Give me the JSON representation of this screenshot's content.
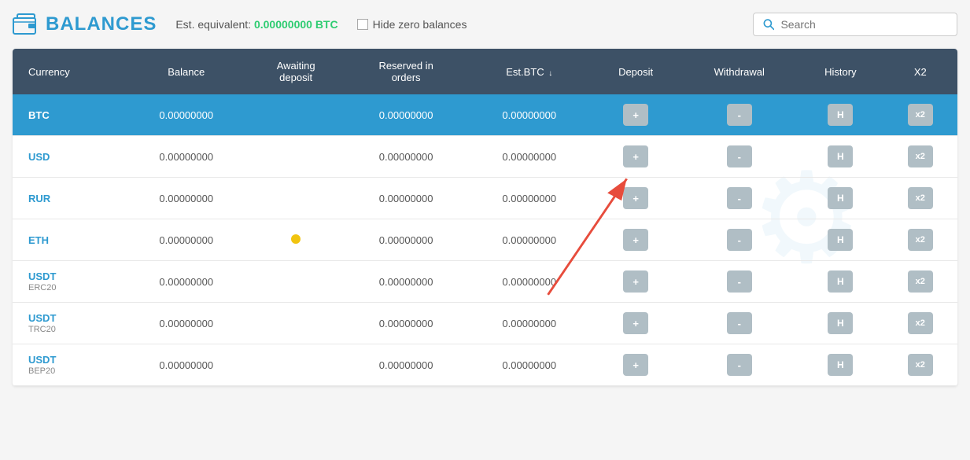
{
  "header": {
    "title": "BALANCES",
    "est_label": "Est. equivalent:",
    "est_value": "0.00000000 BTC",
    "hide_zero_label": "Hide zero balances",
    "search_placeholder": "Search"
  },
  "table": {
    "columns": [
      {
        "key": "currency",
        "label": "Currency"
      },
      {
        "key": "balance",
        "label": "Balance"
      },
      {
        "key": "awaiting",
        "label": "Awaiting deposit"
      },
      {
        "key": "reserved",
        "label": "Reserved in orders"
      },
      {
        "key": "estbtc",
        "label": "Est.BTC",
        "sort": true
      },
      {
        "key": "deposit",
        "label": "Deposit"
      },
      {
        "key": "withdrawal",
        "label": "Withdrawal"
      },
      {
        "key": "history",
        "label": "History"
      },
      {
        "key": "x2",
        "label": "X2"
      }
    ],
    "rows": [
      {
        "currency": "BTC",
        "currency_sub": "",
        "balance": "0.00000000",
        "awaiting": "",
        "reserved": "0.00000000",
        "estbtc": "0.00000000",
        "active": true
      },
      {
        "currency": "USD",
        "currency_sub": "",
        "balance": "0.00000000",
        "awaiting": "",
        "reserved": "0.00000000",
        "estbtc": "0.00000000",
        "active": false
      },
      {
        "currency": "RUR",
        "currency_sub": "",
        "balance": "0.00000000",
        "awaiting": "",
        "reserved": "0.00000000",
        "estbtc": "0.00000000",
        "active": false
      },
      {
        "currency": "ETH",
        "currency_sub": "",
        "balance": "0.00000000",
        "awaiting": "dot",
        "reserved": "0.00000000",
        "estbtc": "0.00000000",
        "active": false
      },
      {
        "currency": "USDT",
        "currency_sub": "ERC20",
        "balance": "0.00000000",
        "awaiting": "",
        "reserved": "0.00000000",
        "estbtc": "0.00000000",
        "active": false
      },
      {
        "currency": "USDT",
        "currency_sub": "TRC20",
        "balance": "0.00000000",
        "awaiting": "",
        "reserved": "0.00000000",
        "estbtc": "0.00000000",
        "active": false
      },
      {
        "currency": "USDT",
        "currency_sub": "BEP20",
        "balance": "0.00000000",
        "awaiting": "",
        "reserved": "0.00000000",
        "estbtc": "0.00000000",
        "active": false
      }
    ],
    "btn_deposit": "+",
    "btn_withdraw": "-",
    "btn_history": "H",
    "btn_x2": "x2"
  }
}
